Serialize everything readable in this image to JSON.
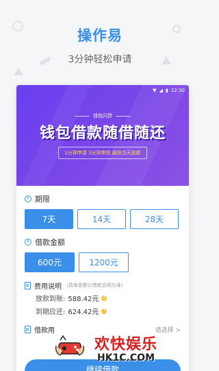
{
  "promo": {
    "headline": "操作易",
    "subline": "3分钟轻松申请"
  },
  "phone": {
    "status_time": "12:30",
    "banner": {
      "small_label": "钱包闪贷",
      "title": "钱包借款随借随还",
      "slogan": "1分钟申请 3分钟审核 最快当天放款"
    },
    "term": {
      "label": "期限",
      "options": [
        "7天",
        "14天",
        "28天"
      ],
      "selected": "7天"
    },
    "amount": {
      "label": "借款金额",
      "options": [
        "600元",
        "1200元"
      ],
      "selected": "600元"
    },
    "fee": {
      "label": "费用说明",
      "note": "(具体金额以借款合同为准)",
      "rows": [
        {
          "label": "放款到账:",
          "value": "588.42元"
        },
        {
          "label": "到期应还:",
          "value": "624.42元"
        }
      ]
    },
    "purpose": {
      "label": "借款用",
      "action": "请选择 >"
    },
    "next_button": "继续借款"
  },
  "watermark": {
    "text_cn": "欢快娱乐",
    "text_url": "HK1C.COM"
  },
  "colors": {
    "accent": "#3a8fe8",
    "banner": "#6a3ff0",
    "watermark_red": "#d62020"
  }
}
